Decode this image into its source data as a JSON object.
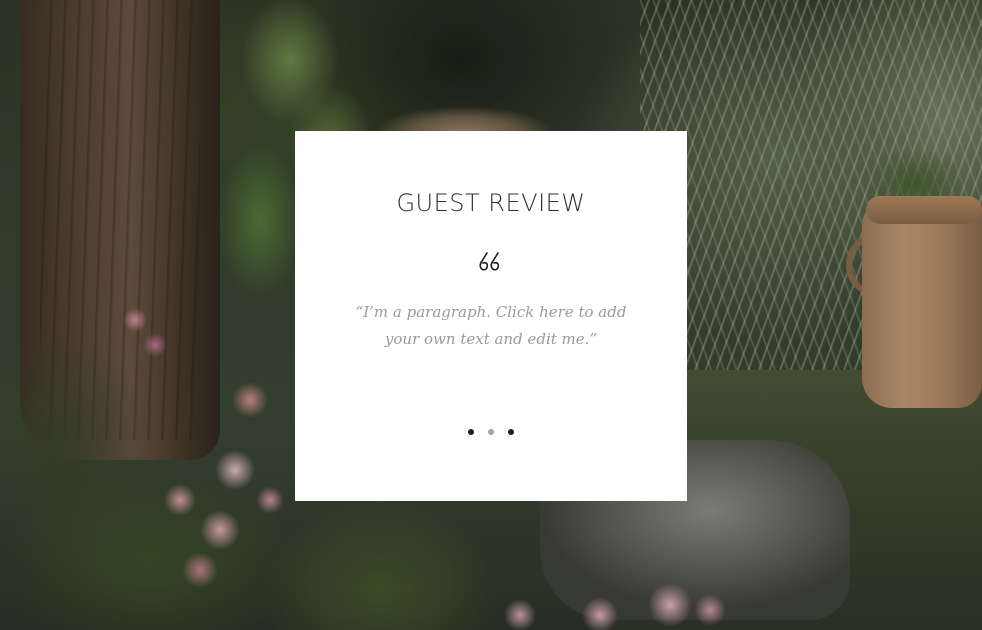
{
  "review": {
    "title": "GUEST REVIEW",
    "quote_icon": "quote-icon",
    "text": "“I’m a paragraph. Click here to add your own text and edit me.”",
    "slides": [
      {
        "label": "slide 1",
        "active": false
      },
      {
        "label": "slide 2",
        "active": true
      },
      {
        "label": "slide 3",
        "active": false
      }
    ]
  },
  "colors": {
    "card_background": "#ffffff",
    "title": "#2f2f2f",
    "body_text": "#9a9a9a",
    "dot": "#1f1f1f",
    "dot_active": "#a3a3a3"
  }
}
